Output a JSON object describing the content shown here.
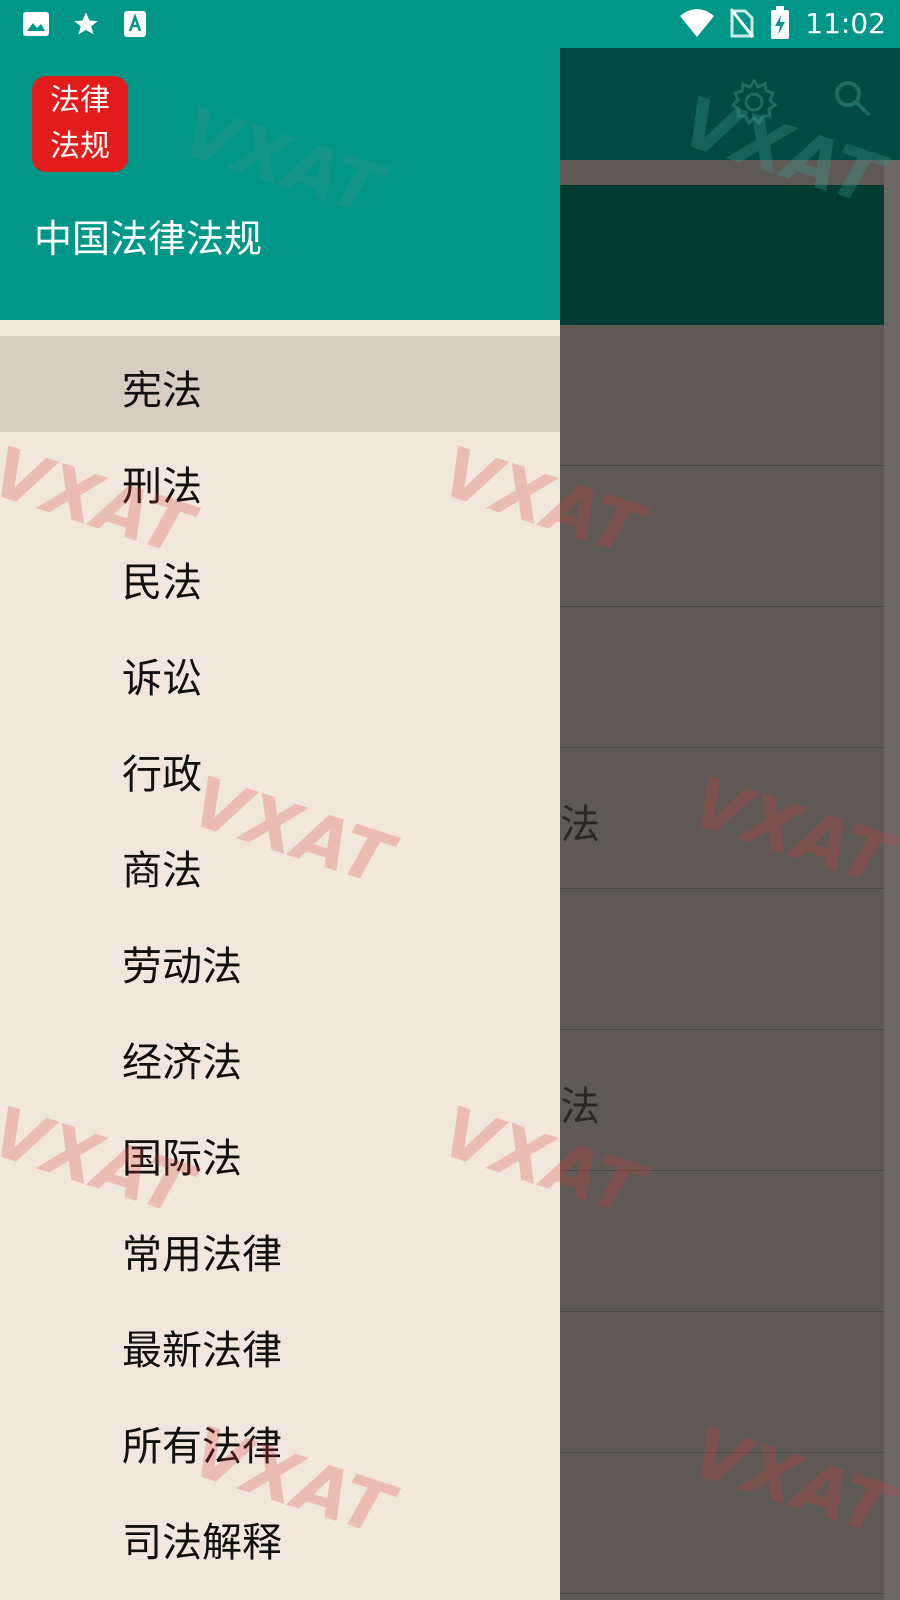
{
  "status_bar": {
    "time": "11:02"
  },
  "app": {
    "rows_partial": [
      "宪法",
      "宪法"
    ]
  },
  "drawer": {
    "logo": [
      "法律",
      "法规"
    ],
    "title": "中国法律法规",
    "items": [
      {
        "label": "宪法",
        "active": true
      },
      {
        "label": "刑法"
      },
      {
        "label": "民法"
      },
      {
        "label": "诉讼"
      },
      {
        "label": "行政"
      },
      {
        "label": "商法"
      },
      {
        "label": "劳动法"
      },
      {
        "label": "经济法"
      },
      {
        "label": "国际法"
      },
      {
        "label": "常用法律"
      },
      {
        "label": "最新法律"
      },
      {
        "label": "所有法律"
      },
      {
        "label": "司法解释"
      }
    ]
  },
  "watermark": "VXAT"
}
